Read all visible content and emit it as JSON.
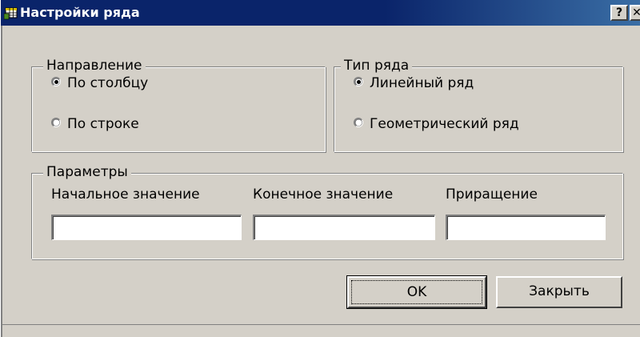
{
  "window": {
    "title": "Настройки ряда",
    "help_button": "?",
    "close_button": "✕",
    "icon": "spreadsheet-app-icon"
  },
  "direction_group": {
    "legend": "Направление",
    "options": [
      {
        "label": "По столбцу",
        "checked": true
      },
      {
        "label": "По строке",
        "checked": false
      }
    ]
  },
  "series_type_group": {
    "legend": "Тип ряда",
    "options": [
      {
        "label": "Линейный ряд",
        "checked": true
      },
      {
        "label": "Геометрический ряд",
        "checked": false
      }
    ]
  },
  "parameters_group": {
    "legend": "Параметры",
    "start_label": "Начальное значение",
    "end_label": "Конечное значение",
    "step_label": "Приращение",
    "start_value": "",
    "end_value": "",
    "step_value": ""
  },
  "buttons": {
    "ok_label": "OK",
    "close_label": "Закрыть"
  },
  "colors": {
    "titlebar": "#0a246a",
    "face": "#d4d0c8"
  }
}
